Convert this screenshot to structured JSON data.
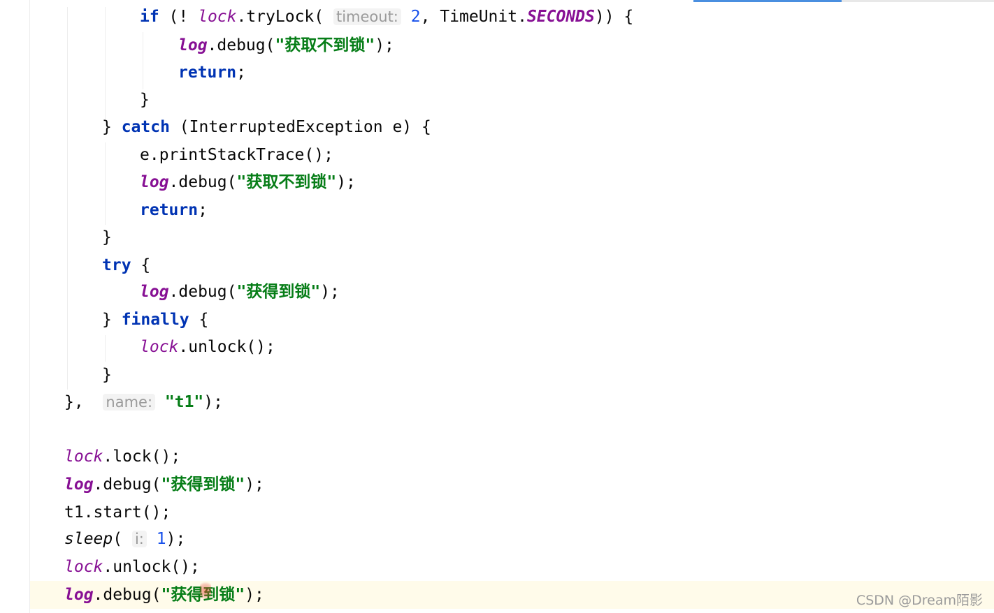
{
  "colors": {
    "keyword": "#0033b3",
    "field": "#871094",
    "string": "#067d17",
    "number": "#1750eb",
    "hint": "#9a9a9a",
    "current_line": "#fffbea"
  },
  "code": {
    "l1": {
      "kw_if": "if",
      "t1": " (! ",
      "field_lock": "lock",
      "t2": ".tryLock( ",
      "hint_timeout": "timeout:",
      "t3": " ",
      "num_2": "2",
      "t4": ", TimeUnit.",
      "field_seconds": "SECONDS",
      "t5": ")) {"
    },
    "l2": {
      "field_log": "log",
      "t1": ".debug(",
      "str": "\"获取不到锁\"",
      "t2": ");"
    },
    "l3": {
      "kw_return": "return",
      "t1": ";"
    },
    "l4": {
      "t1": "}"
    },
    "l5": {
      "t1": "} ",
      "kw_catch": "catch",
      "t2": " (InterruptedException e) {"
    },
    "l6": {
      "t1": "e.printStackTrace();"
    },
    "l7": {
      "field_log": "log",
      "t1": ".debug(",
      "str": "\"获取不到锁\"",
      "t2": ");"
    },
    "l8": {
      "kw_return": "return",
      "t1": ";"
    },
    "l9": {
      "t1": "}"
    },
    "l10": {
      "kw_try": "try",
      "t1": " {"
    },
    "l11": {
      "field_log": "log",
      "t1": ".debug(",
      "str": "\"获得到锁\"",
      "t2": ");"
    },
    "l12": {
      "t1": "} ",
      "kw_finally": "finally",
      "t2": " {"
    },
    "l13": {
      "field_lock": "lock",
      "t1": ".unlock();"
    },
    "l14": {
      "t1": "}"
    },
    "l15": {
      "t1": "},  ",
      "hint_name": "name:",
      "t2": " ",
      "str": "\"t1\"",
      "t3": ");"
    },
    "l16": {
      "field_lock": "lock",
      "t1": ".lock();"
    },
    "l17": {
      "field_log": "log",
      "t1": ".debug(",
      "str": "\"获得到锁\"",
      "t2": ");"
    },
    "l18": {
      "t1": "t1.start();"
    },
    "l19": {
      "method_sleep": "sleep",
      "t1": "( ",
      "hint_i": "i:",
      "t2": " ",
      "num_1": "1",
      "t3": ");"
    },
    "l20": {
      "field_lock": "lock",
      "t1": ".unlock();"
    },
    "l21": {
      "field_log": "log",
      "t1": ".debug(",
      "str": "\"获得到锁\"",
      "t2": ");"
    }
  },
  "watermark": "CSDN @Dream陌影"
}
